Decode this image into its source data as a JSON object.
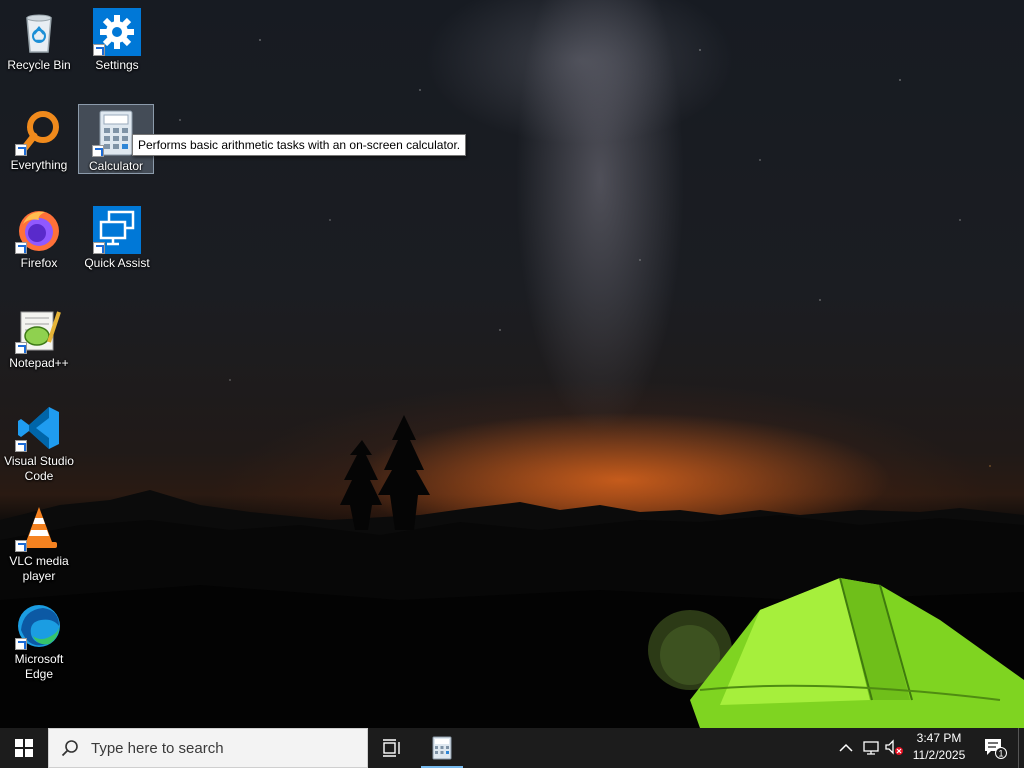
{
  "desktop": {
    "icons": [
      {
        "label": "Recycle Bin",
        "icon": "recycle-bin-icon"
      },
      {
        "label": "Settings",
        "icon": "settings-gear-icon"
      },
      {
        "label": "Everything",
        "icon": "everything-search-icon"
      },
      {
        "label": "Calculator",
        "icon": "calculator-icon"
      },
      {
        "label": "Firefox",
        "icon": "firefox-icon"
      },
      {
        "label": "Quick Assist",
        "icon": "quick-assist-icon"
      },
      {
        "label": "Notepad++",
        "icon": "notepad-plus-plus-icon"
      },
      {
        "label": "Visual Studio Code",
        "icon": "vscode-icon"
      },
      {
        "label": "VLC media player",
        "icon": "vlc-icon"
      },
      {
        "label": "Microsoft Edge",
        "icon": "edge-icon"
      }
    ],
    "tooltip": "Performs basic arithmetic tasks with an on-screen calculator."
  },
  "taskbar": {
    "search_placeholder": "Type here to search",
    "clock_time": "3:47 PM",
    "clock_date": "11/2/2025",
    "notification_count": "1"
  },
  "colors": {
    "taskbar_bg": "#1c1c1c",
    "accent": "#0078d7",
    "active_indicator": "#76b9ed",
    "tent_green": "#8ee02a"
  }
}
